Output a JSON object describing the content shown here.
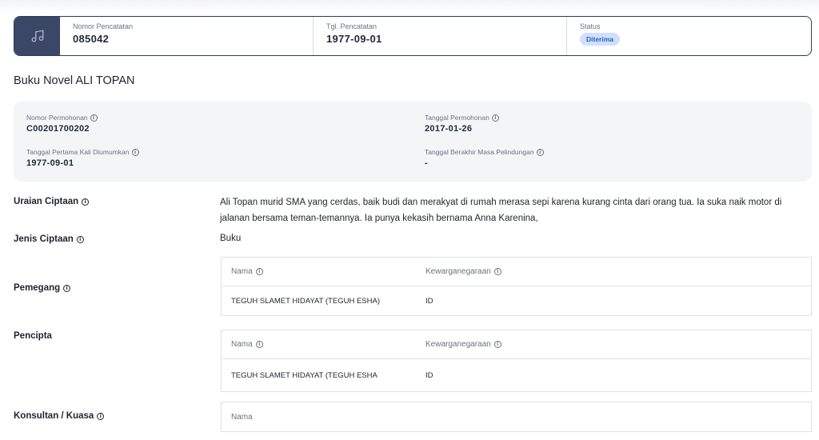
{
  "header": {
    "icon": "music-note-icon",
    "registration_number_label": "Nomor Pencatatan",
    "registration_number": "085042",
    "registration_date_label": "Tgl. Pencatatan",
    "registration_date": "1977-09-01",
    "status_label": "Status",
    "status": "Diterima"
  },
  "page_title": "Buku Novel ALI TOPAN",
  "info": {
    "application_number_label": "Nomor Permohonan",
    "application_number": "C00201700202",
    "application_date_label": "Tanggal Permohonan",
    "application_date": "2017-01-26",
    "first_published_label": "Tanggal Pertama Kali Diumumkan",
    "first_published": "1977-09-01",
    "protection_end_label": "Tanggal Berakhir Masa Pelindungan",
    "protection_end": "-"
  },
  "details": {
    "description_label": "Uraian Ciptaan",
    "description": "Ali Topan murid SMA yang cerdas, baik budi dan merakyat di rumah merasa sepi karena kurang cinta dari orang tua. Ia suka naik motor di jalanan bersama teman-temannya. Ia punya kekasih bernama Anna Karenina,",
    "type_label": "Jenis Ciptaan",
    "type": "Buku",
    "holder_label": "Pemegang",
    "creator_label": "Pencipta",
    "consultant_label": "Konsultan / Kuasa"
  },
  "holder_table": {
    "headers": [
      "Nama",
      "Kewarganegaraan"
    ],
    "rows": [
      [
        "TEGUH SLAMET HIDAYAT (TEGUH ESHA)",
        "ID"
      ]
    ]
  },
  "creator_table": {
    "headers": [
      "Nama",
      "Kewarganegaraan"
    ],
    "rows": [
      [
        "TEGUH SLAMET HIDAYAT (TEGUH ESHA",
        "ID"
      ]
    ]
  },
  "consultant_table": {
    "headers": [
      "Nama"
    ]
  },
  "colors": {
    "header_border": "#2f3a55",
    "icon_box": "#3b4766",
    "badge_bg": "#cfe0ff",
    "badge_text": "#2f5fb3",
    "panel_bg": "#f4f5f7"
  }
}
